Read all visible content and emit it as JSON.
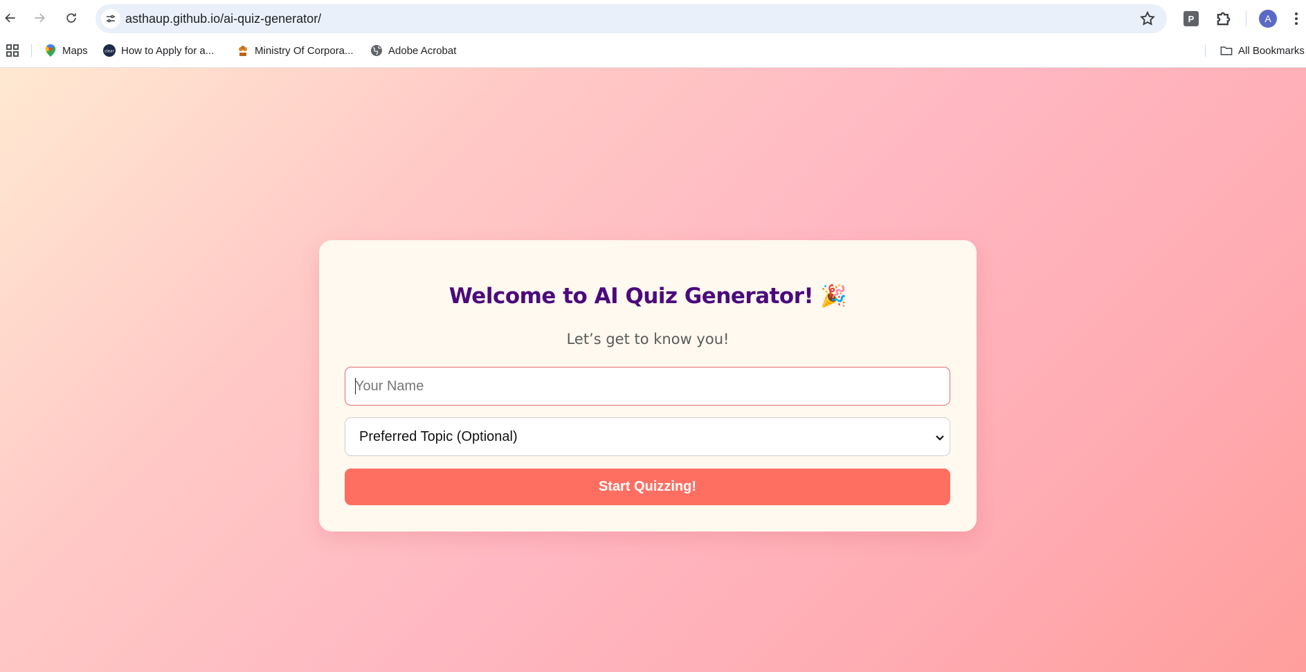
{
  "browser": {
    "url": "asthaup.github.io/ai-quiz-generator/",
    "extension_letter": "P",
    "avatar_letter": "A",
    "bookmarks": [
      {
        "label": "Maps",
        "icon": "google-maps-icon"
      },
      {
        "label": "How to Apply for a...",
        "icon": "clear-icon"
      },
      {
        "label": "Ministry Of Corpora...",
        "icon": "emblem-icon"
      },
      {
        "label": "Adobe Acrobat",
        "icon": "globe-icon"
      }
    ],
    "all_bookmarks_label": "All Bookmarks"
  },
  "page": {
    "title": "Welcome to AI Quiz Generator!",
    "title_emoji": "🎉",
    "subtitle": "Let’s get to know you!",
    "name_placeholder": "Your Name",
    "name_value": "",
    "topic_selected": "Preferred Topic (Optional)",
    "start_label": "Start Quizzing!"
  },
  "colors": {
    "title": "#4b0a7c",
    "button": "#ff6f61",
    "card": "#fff9ef",
    "input_border": "#e36a6a"
  }
}
